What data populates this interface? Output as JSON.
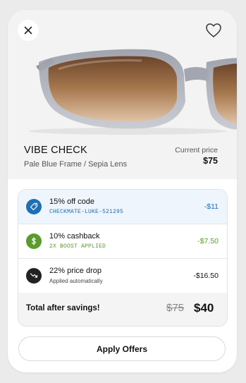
{
  "product": {
    "name": "VIBE CHECK",
    "variant": "Pale Blue Frame / Sepia Lens",
    "price_label": "Current price",
    "price": "$75",
    "image_icon": "sunglasses-image"
  },
  "offers": [
    {
      "title": "15% off code",
      "detail": "CHECKMATE-LUKE-521295",
      "amount": "-$11",
      "icon": "tag-icon",
      "color": "#1d6fb8",
      "selected": true
    },
    {
      "title": "10% cashback",
      "detail": "2X BOOST APPLIED",
      "amount": "-$7.50",
      "icon": "dollar-icon",
      "color": "#5b9a2d",
      "selected": false
    },
    {
      "title": "22% price drop",
      "detail": "Applied automatically",
      "amount": "-$16.50",
      "icon": "trend-down-icon",
      "color": "#222222",
      "selected": false
    }
  ],
  "total": {
    "label": "Total after savings!",
    "original": "$75",
    "final": "$40"
  },
  "apply_button": "Apply Offers",
  "colors": {
    "card": "#ffffff",
    "hero_bg": "#f3f3f3",
    "selected_row": "#eef5fc",
    "blue": "#1d6fb8",
    "green": "#5b9a2d"
  }
}
